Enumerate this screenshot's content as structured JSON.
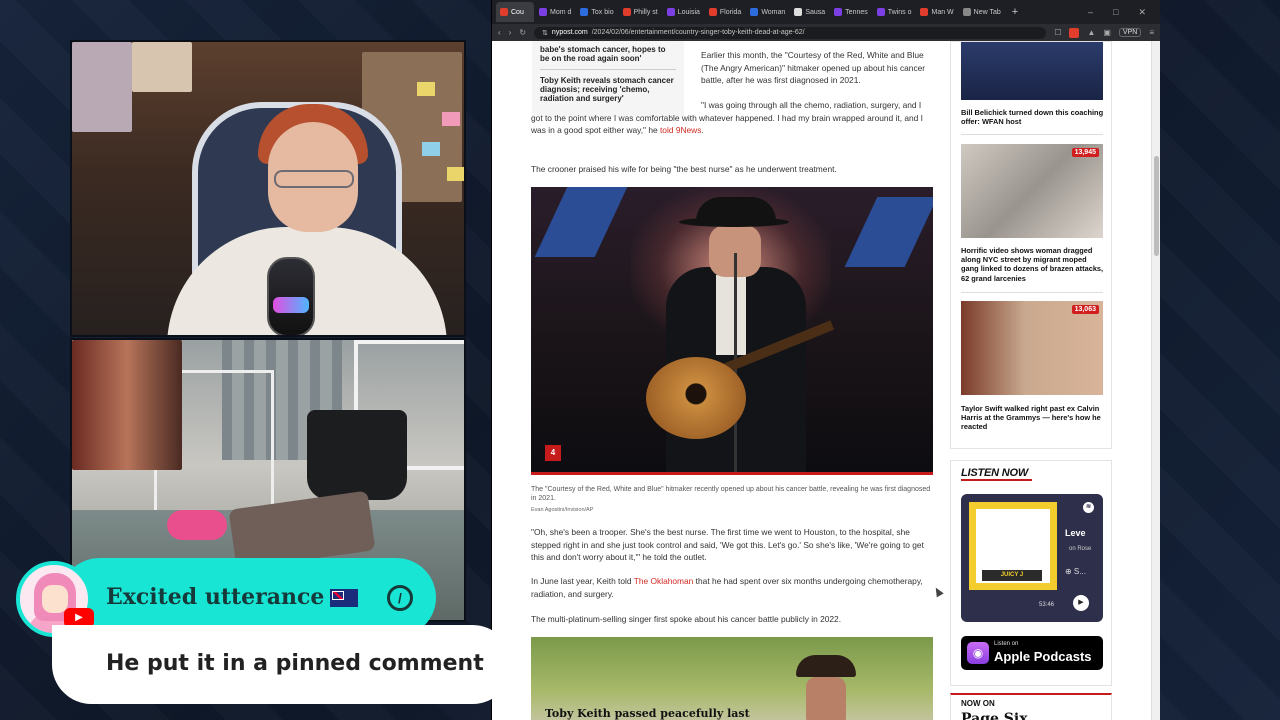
{
  "browser": {
    "tabs": [
      {
        "label": "Cou",
        "color": "#e03d2c",
        "active": true
      },
      {
        "label": "Mom d",
        "color": "#7b3fe4"
      },
      {
        "label": "Tox bio",
        "color": "#2d6cdf"
      },
      {
        "label": "Philly st",
        "color": "#e03d2c"
      },
      {
        "label": "Louisia",
        "color": "#7b3fe4"
      },
      {
        "label": "Florida",
        "color": "#e03d2c"
      },
      {
        "label": "Woman",
        "color": "#2d6cdf"
      },
      {
        "label": "Sausa",
        "color": "#dddddd"
      },
      {
        "label": "Tennes",
        "color": "#7b3fe4"
      },
      {
        "label": "Twins o",
        "color": "#7b3fe4"
      },
      {
        "label": "Man W",
        "color": "#e03d2c"
      },
      {
        "label": "New Tab",
        "color": "#888888"
      }
    ],
    "new_tab_symbol": "+",
    "window_controls": [
      "–",
      "□",
      "✕"
    ],
    "url_domain": "nypost.com",
    "url_path": "/2024/02/06/entertainment/country-singer-toby-keith-dead-at-age-62/",
    "vpn_label": "VPN"
  },
  "article": {
    "related": [
      "babe's stomach cancer, hopes to be on the road again soon'",
      "Toby Keith reveals stomach cancer diagnosis; receiving 'chemo, radiation and surgery'"
    ],
    "para1": "Earlier this month, the \"Courtesy of the Red, White and Blue (The Angry American)\" hitmaker opened up about his cancer battle, after he was first diagnosed in 2021.",
    "para2_a": "\"I was going through all the chemo, radiation, surgery, and I got to the point where I was comfortable with whatever happened. I had my brain wrapped around it, and I was in a good spot either way,\" he ",
    "para2_link": "told 9News",
    "para2_b": ".",
    "para3": "The crooner praised his wife for being \"the best nurse\" as he underwent treatment.",
    "gallery_count": "4",
    "caption": "The \"Courtesy of the Red, White and Blue\" hitmaker recently opened up about his cancer battle, revealing he was first diagnosed in 2021.",
    "credit": "Evan Agostini/Invision/AP",
    "para4": "\"Oh, she's been a trooper. She's the best nurse. The first time we went to Houston, to the hospital, she stepped right in and she just took control and said, 'We got this. Let's go.' So she's like, 'We're going to get this and don't worry about it,'\" he told the outlet.",
    "para5_a": "In June last year, Keith told ",
    "para5_link": "The Oklahoman",
    "para5_b": " that he had spent over six months undergoing chemotherapy, radiation, and surgery.",
    "para6": "The multi-platinum-selling singer first spoke about his cancer battle publicly in 2022.",
    "second_image_text": "Toby Keith passed peacefully last"
  },
  "sidebar": {
    "stories": [
      {
        "title": "Bill Belichick turned down this coaching offer: WFAN host",
        "count": ""
      },
      {
        "title": "Horrific video shows woman dragged along NYC street by migrant moped gang linked to dozens of brazen attacks, 62 grand larcenies",
        "count": "13,945"
      },
      {
        "title": "Taylor Swift walked right past ex Calvin Harris at the Grammys — here's how he reacted",
        "count": "13,063"
      }
    ],
    "listen_now": "LISTEN NOW",
    "spotify": {
      "title": "Leve",
      "subtitle": "on Rose",
      "plus": "⊕ S...",
      "time": "53:46",
      "album_label": "JUICY J"
    },
    "apple": {
      "small": "Listen on",
      "big": "Apple Podcasts"
    },
    "now_on": "NOW ON",
    "now_on_show": "Page Six"
  },
  "chat": {
    "username": "Excited utterance",
    "message": "He put it in a pinned comment",
    "platform": "YouTube",
    "accent": "#19e5d5"
  }
}
